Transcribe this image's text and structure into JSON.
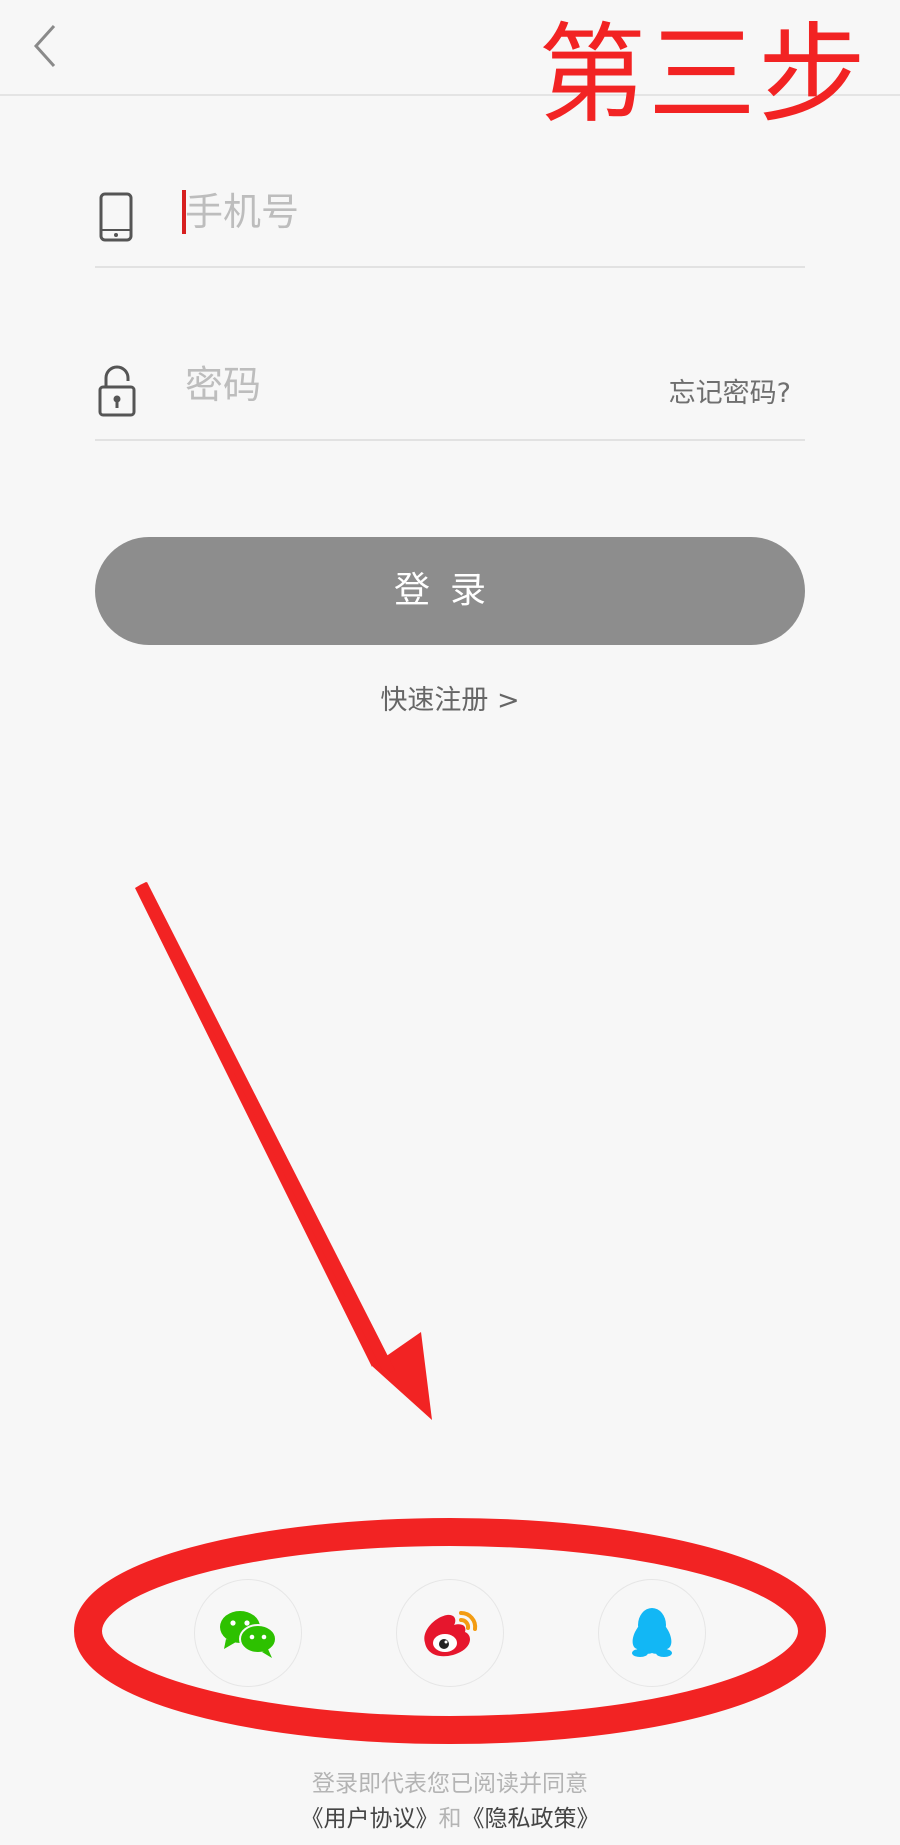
{
  "header": {
    "step_label": "第三步"
  },
  "form": {
    "phone_placeholder": "手机号",
    "password_placeholder": "密码",
    "forgot_label": "忘记密码?",
    "login_label": "登录",
    "register_label": "快速注册 >"
  },
  "social": [
    {
      "name": "wechat",
      "color": "#2dc100"
    },
    {
      "name": "weibo",
      "color": "#e6162d"
    },
    {
      "name": "qq",
      "color": "#12b7f5"
    }
  ],
  "terms": {
    "line1": "登录即代表您已阅读并同意",
    "user_agreement": "《用户协议》",
    "and": "和",
    "privacy_policy": "《隐私政策》"
  },
  "colors": {
    "annotation_red": "#f22323",
    "button_gray": "#8d8d8d"
  }
}
